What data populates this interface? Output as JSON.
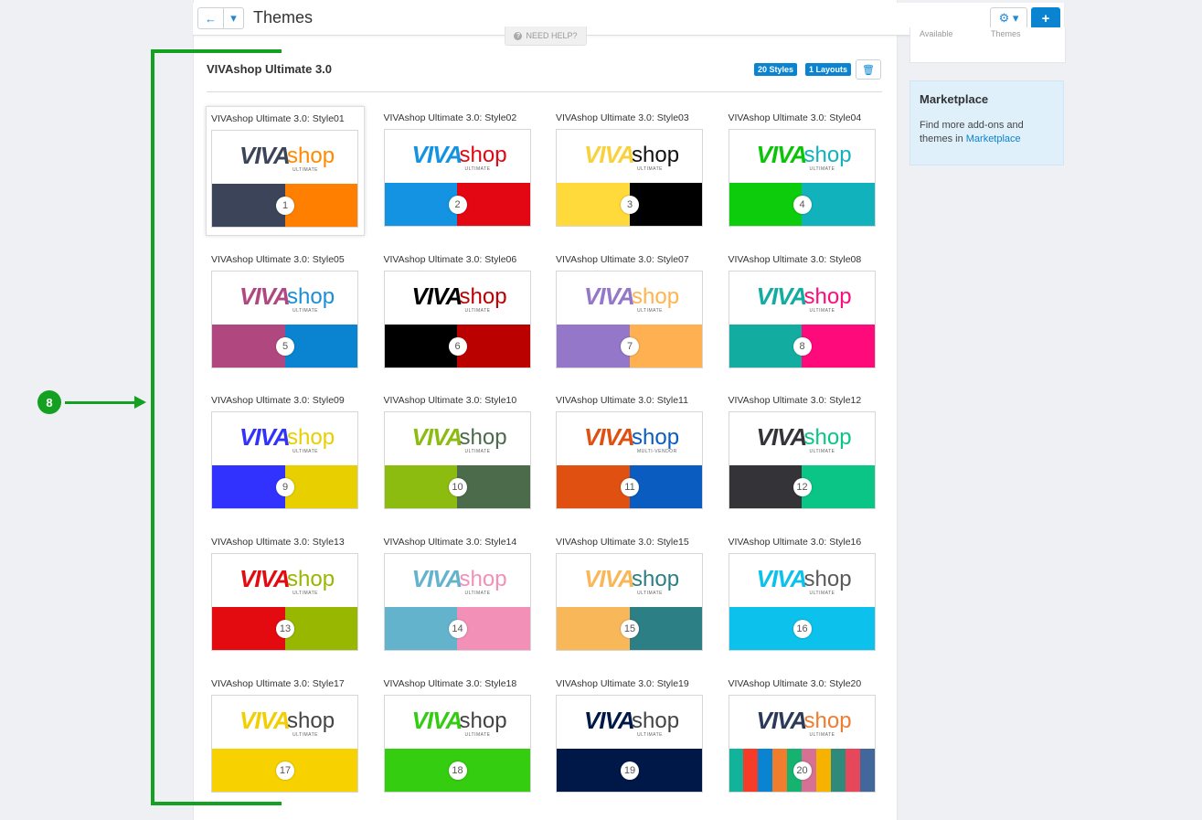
{
  "header": {
    "title": "Themes",
    "back_icon": "←",
    "dropdown_icon": "▾",
    "gear_icon": "⚙ ▾",
    "add_icon": "+"
  },
  "need_help": "NEED HELP?",
  "theme": {
    "name": "VIVAshop Ultimate 3.0",
    "styles_badge": "20 Styles",
    "layouts_badge": "1 Layouts",
    "delete_icon": "🗑"
  },
  "sidebar": {
    "top_card_left": "Available",
    "top_card_right": "Themes",
    "marketplace_title": "Marketplace",
    "marketplace_text": "Find more add-ons and themes in ",
    "marketplace_link": "Marketplace"
  },
  "callout": "8",
  "logo_word": "shop",
  "styles": [
    {
      "title": "VIVAshop Ultimate 3.0: Style01",
      "num": "1",
      "sub": "ULTIMATE",
      "viva": "#3b4458",
      "shop": "#ff8a00",
      "colors": [
        "#3b4458",
        "#ff7f00"
      ]
    },
    {
      "title": "VIVAshop Ultimate 3.0: Style02",
      "num": "2",
      "sub": "ULTIMATE",
      "viva": "#1393e1",
      "shop": "#e30613",
      "colors": [
        "#1393e1",
        "#e30613"
      ]
    },
    {
      "title": "VIVAshop Ultimate 3.0: Style03",
      "num": "3",
      "sub": "ULTIMATE",
      "viva": "#f7d23c",
      "shop": "#111111",
      "colors": [
        "#ffda3a",
        "#000000"
      ]
    },
    {
      "title": "VIVAshop Ultimate 3.0: Style04",
      "num": "4",
      "sub": "ULTIMATE",
      "viva": "#0ac40a",
      "shop": "#12b2bd",
      "colors": [
        "#0ccc0c",
        "#12b2bd"
      ]
    },
    {
      "title": "VIVAshop Ultimate 3.0: Style05",
      "num": "5",
      "sub": "ULTIMATE",
      "viva": "#b0487f",
      "shop": "#1a8fd8",
      "colors": [
        "#b0487f",
        "#0a84d0"
      ]
    },
    {
      "title": "VIVAshop Ultimate 3.0: Style06",
      "num": "6",
      "sub": "ULTIMATE",
      "viva": "#000000",
      "shop": "#c00000",
      "colors": [
        "#000000",
        "#bb0000"
      ]
    },
    {
      "title": "VIVAshop Ultimate 3.0: Style07",
      "num": "7",
      "sub": "ULTIMATE",
      "viva": "#9477c9",
      "shop": "#ffb44e",
      "colors": [
        "#9477c9",
        "#ffb050"
      ]
    },
    {
      "title": "VIVAshop Ultimate 3.0: Style08",
      "num": "8",
      "sub": "ULTIMATE",
      "viva": "#12ada0",
      "shop": "#ff0a7b",
      "colors": [
        "#12ada0",
        "#ff0a7b"
      ]
    },
    {
      "title": "VIVAshop Ultimate 3.0: Style09",
      "num": "9",
      "sub": "ULTIMATE",
      "viva": "#3232ff",
      "shop": "#e8cf00",
      "colors": [
        "#3232ff",
        "#e8cf00"
      ]
    },
    {
      "title": "VIVAshop Ultimate 3.0: Style10",
      "num": "10",
      "sub": "ULTIMATE",
      "viva": "#8cbc10",
      "shop": "#4b6b4a",
      "colors": [
        "#8cbc10",
        "#4b6b4a"
      ]
    },
    {
      "title": "VIVAshop Ultimate 3.0: Style11",
      "num": "11",
      "sub": "MULTI-VENDOR",
      "viva": "#e05010",
      "shop": "#0a5cc0",
      "colors": [
        "#e05010",
        "#0a5cc0"
      ]
    },
    {
      "title": "VIVAshop Ultimate 3.0: Style12",
      "num": "12",
      "sub": "ULTIMATE",
      "viva": "#333338",
      "shop": "#0bc587",
      "colors": [
        "#333338",
        "#0bc587"
      ]
    },
    {
      "title": "VIVAshop Ultimate 3.0: Style13",
      "num": "13",
      "sub": "ULTIMATE",
      "viva": "#e30b10",
      "shop": "#98b700",
      "colors": [
        "#e30b10",
        "#98b700"
      ]
    },
    {
      "title": "VIVAshop Ultimate 3.0: Style14",
      "num": "14",
      "sub": "ULTIMATE",
      "viva": "#64b3cc",
      "shop": "#f390b8",
      "colors": [
        "#64b3cc",
        "#f390b8"
      ]
    },
    {
      "title": "VIVAshop Ultimate 3.0: Style15",
      "num": "15",
      "sub": "ULTIMATE",
      "viva": "#f8b85a",
      "shop": "#2c7f84",
      "colors": [
        "#f8b85a",
        "#2c7f84"
      ]
    },
    {
      "title": "VIVAshop Ultimate 3.0: Style16",
      "num": "16",
      "sub": "ULTIMATE",
      "viva": "#0cc2ec",
      "shop": "#5a5a5a",
      "colors": [
        "#0cc2ec",
        "#0cc2ec"
      ]
    },
    {
      "title": "VIVAshop Ultimate 3.0: Style17",
      "num": "17",
      "sub": "ULTIMATE",
      "viva": "#f3cf00",
      "shop": "#444444",
      "colors": [
        "#f8d200",
        "#f8d200"
      ]
    },
    {
      "title": "VIVAshop Ultimate 3.0: Style18",
      "num": "18",
      "sub": "ULTIMATE",
      "viva": "#32cc10",
      "shop": "#444444",
      "colors": [
        "#34cd10",
        "#34cd10"
      ]
    },
    {
      "title": "VIVAshop Ultimate 3.0: Style19",
      "num": "19",
      "sub": "ULTIMATE",
      "viva": "#001848",
      "shop": "#444444",
      "colors": [
        "#001848",
        "#001848"
      ]
    },
    {
      "title": "VIVAshop Ultimate 3.0: Style20",
      "num": "20",
      "sub": "ULTIMATE",
      "viva": "#2b3a58",
      "shop": "#f07c2e",
      "colors": [
        "#12b39b",
        "#f63b29",
        "#0a84d0",
        "#f07c2e",
        "#16b370",
        "#d67094",
        "#f7b200",
        "#2f8a7c",
        "#e6475a",
        "#41679b"
      ]
    }
  ]
}
